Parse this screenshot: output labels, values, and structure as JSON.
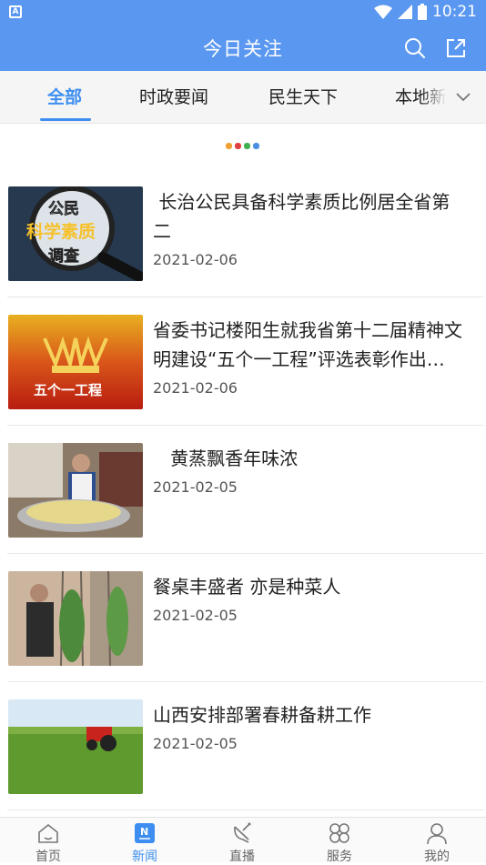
{
  "status_bar": {
    "left_icon_letter": "A",
    "time": "10:21"
  },
  "header": {
    "title": "今日关注",
    "icons": [
      "search-icon",
      "share-icon"
    ]
  },
  "tabs": [
    {
      "label": "全部",
      "active": true
    },
    {
      "label": "时政要闻",
      "active": false
    },
    {
      "label": "民生天下",
      "active": false
    },
    {
      "label": "本地新闻",
      "active": false
    }
  ],
  "loader_colors": [
    "#f0a030",
    "#e04040",
    "#40b050",
    "#4a90e2"
  ],
  "news": [
    {
      "title": " 长治公民具备科学素质比例居全省第二",
      "date": "2021-02-06",
      "thumb_text": [
        "公民",
        "科学素质",
        "调查"
      ]
    },
    {
      "title": "省委书记楼阳生就我省第十二届精神文明建设“五个一工程”评选表彰作出批示",
      "date": "2021-02-06",
      "thumb_text": [
        "五个一工程"
      ]
    },
    {
      "title": "   黄蒸飘香年味浓",
      "date": "2021-02-05"
    },
    {
      "title": "餐桌丰盛者 亦是种菜人",
      "date": "2021-02-05"
    },
    {
      "title": "山西安排部署春耕备耕工作",
      "date": "2021-02-05"
    }
  ],
  "bottom_nav": [
    {
      "label": "首页",
      "icon": "home-icon",
      "active": false
    },
    {
      "label": "新闻",
      "icon": "news-icon",
      "active": true
    },
    {
      "label": "直播",
      "icon": "live-icon",
      "active": false
    },
    {
      "label": "服务",
      "icon": "service-icon",
      "active": false
    },
    {
      "label": "我的",
      "icon": "profile-icon",
      "active": false
    }
  ],
  "colors": {
    "brand": "#5a97f0",
    "active": "#3d8ef0"
  }
}
